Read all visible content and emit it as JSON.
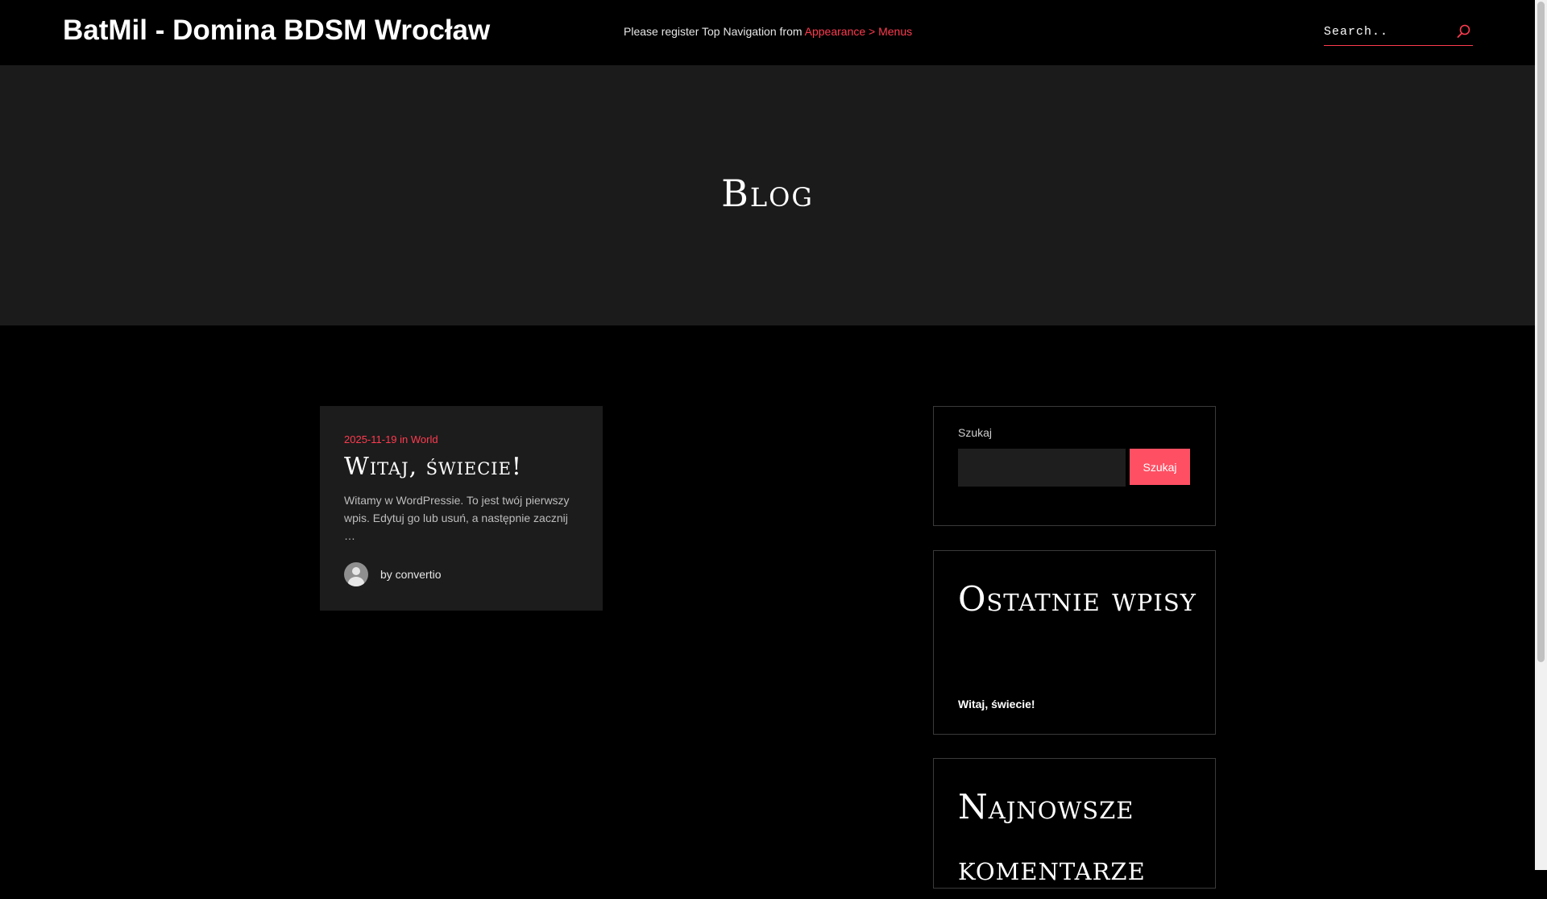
{
  "header": {
    "site_title": "BatMil - Domina BDSM Wrocław",
    "nav_note": "Please register Top Navigation from ",
    "nav_link": "Appearance > Menus",
    "search_placeholder": "Search..",
    "search_icon": "search-icon"
  },
  "hero": {
    "title": "Blog"
  },
  "post": {
    "date": "2025-11-19",
    "in_text": " in ",
    "category": "World",
    "title": "Witaj, świecie!",
    "excerpt": "Witamy w WordPressie. To jest twój pierwszy wpis. Edytuj go lub usuń, a następnie zacznij …",
    "author": "by convertio"
  },
  "sidebar": {
    "search": {
      "label": "Szukaj",
      "button": "Szukaj"
    },
    "recent": {
      "heading": "Ostatnie wpisy",
      "items": [
        "Witaj, świecie!"
      ]
    },
    "comments": {
      "heading": "Najnowsze komentarze"
    }
  },
  "colors": {
    "accent": "#ff3b4f",
    "background": "#000000",
    "hero_bg": "#1b1b1b",
    "card_bg": "#1c1c1c"
  }
}
